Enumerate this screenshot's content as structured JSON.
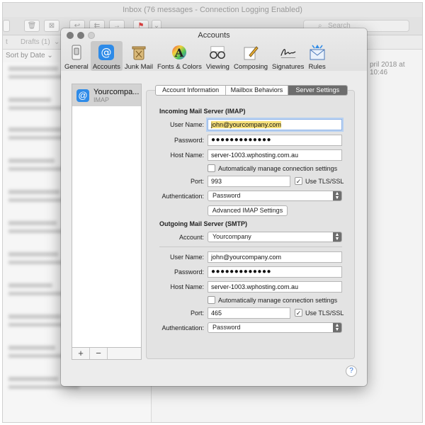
{
  "background": {
    "window_title": "Inbox (76 messages - Connection Logging Enabled)",
    "search_placeholder": "Search",
    "favbar": {
      "item1": "t",
      "item2": "Drafts (1)",
      "chev": "⌄"
    },
    "list_sort_label": "Sort by Date",
    "date_snippet": "pril 2018 at 10:46"
  },
  "prefs": {
    "window_title": "Accounts",
    "tabs": [
      {
        "label": "General",
        "icon": "switch-icon"
      },
      {
        "label": "Accounts",
        "icon": "at-icon"
      },
      {
        "label": "Junk Mail",
        "icon": "trash-icon"
      },
      {
        "label": "Fonts & Colors",
        "icon": "font-icon"
      },
      {
        "label": "Viewing",
        "icon": "glasses-icon"
      },
      {
        "label": "Composing",
        "icon": "pencil-icon"
      },
      {
        "label": "Signatures",
        "icon": "signature-icon"
      },
      {
        "label": "Rules",
        "icon": "rules-icon"
      }
    ],
    "active_tab": "Accounts"
  },
  "account_list": {
    "items": [
      {
        "name": "Yourcompa...",
        "type": "IMAP"
      }
    ],
    "add_label": "+",
    "remove_label": "−"
  },
  "segments": [
    {
      "label": "Account Information"
    },
    {
      "label": "Mailbox Behaviors"
    },
    {
      "label": "Server Settings"
    }
  ],
  "active_segment": "Server Settings",
  "incoming": {
    "title": "Incoming Mail Server (IMAP)",
    "user_label": "User Name:",
    "user_value": "john@yourcompany.com",
    "password_label": "Password:",
    "password_value": "●●●●●●●●●●●●●",
    "host_label": "Host Name:",
    "host_value": "server-1003.wphosting.com.au",
    "auto_manage_label": "Automatically manage connection settings",
    "auto_manage_checked": false,
    "port_label": "Port:",
    "port_value": "993",
    "tls_label": "Use TLS/SSL",
    "tls_checked": true,
    "auth_label": "Authentication:",
    "auth_value": "Password",
    "advanced_button": "Advanced IMAP Settings"
  },
  "outgoing": {
    "title": "Outgoing Mail Server (SMTP)",
    "account_label": "Account:",
    "account_value": "Yourcompany",
    "user_label": "User Name:",
    "user_value": "john@yourcompany.com",
    "password_label": "Password:",
    "password_value": "●●●●●●●●●●●●●",
    "host_label": "Host Name:",
    "host_value": "server-1003.wphosting.com.au",
    "auto_manage_label": "Automatically manage connection settings",
    "auto_manage_checked": false,
    "port_label": "Port:",
    "port_value": "465",
    "tls_label": "Use TLS/SSL",
    "tls_checked": true,
    "auth_label": "Authentication:",
    "auth_value": "Password"
  },
  "help_label": "?",
  "colors": {
    "accent_blue": "#2e8be8",
    "segment_active": "#6d6d6d",
    "selection_yellow": "#f7e07a"
  }
}
